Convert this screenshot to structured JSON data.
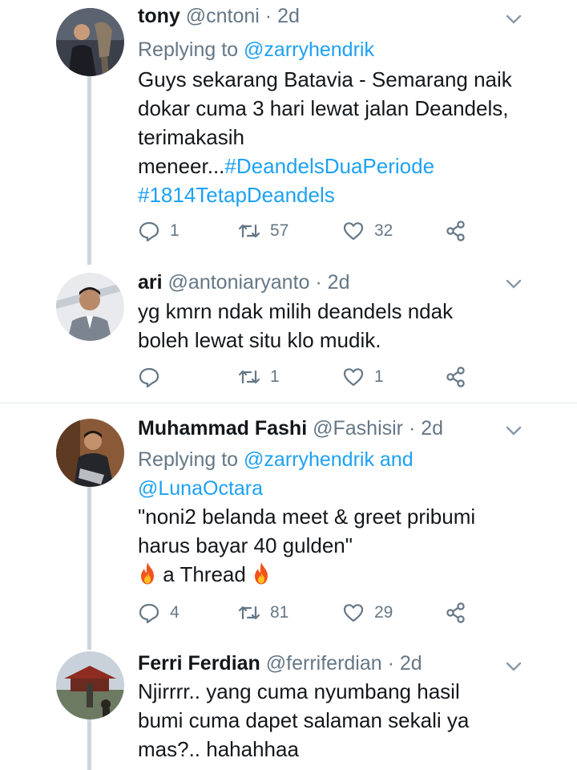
{
  "tweets": [
    {
      "name": "tony",
      "handle": "@cntoni",
      "sep": "·",
      "time": "2d",
      "replying_prefix": "Replying to",
      "replying_to": "@zarryhendrik",
      "body_lines": [
        "Guys sekarang Batavia - Semarang naik",
        "dokar cuma 3 hari lewat jalan Deandels,",
        "terimakasih"
      ],
      "body_tail_text": "meneer...",
      "hashtag_1": "#DeandelsDuaPeriode",
      "hashtag_2": "#1814TetapDeandels",
      "replies": "1",
      "retweets": "57",
      "likes": "32"
    },
    {
      "name": "ari",
      "handle": "@antoniaryanto",
      "sep": "·",
      "time": "2d",
      "body_lines": [
        "yg kmrn ndak milih deandels ndak",
        "boleh lewat situ klo mudik."
      ],
      "replies": "",
      "retweets": "1",
      "likes": "1"
    },
    {
      "name": "Muhammad Fashi",
      "handle": "@Fashisir",
      "sep": "·",
      "time": "2d",
      "replying_prefix": "Replying to",
      "replying_to": "@zarryhendrik",
      "replying_and": "and",
      "replying_to_2": "@LunaOctara",
      "body_lines": [
        "\"noni2 belanda meet & greet pribumi",
        "harus bayar 40 gulden\""
      ],
      "thread_text": "a Thread",
      "replies": "4",
      "retweets": "81",
      "likes": "29"
    },
    {
      "name": "Ferri Ferdian",
      "handle": "@ferriferdian",
      "sep": "·",
      "time": "2d",
      "body_lines": [
        "Njirrrr.. yang cuma nyumbang hasil",
        "bumi cuma dapet salaman sekali ya",
        "mas?.. hahahhaa"
      ]
    }
  ],
  "icons": {
    "reply": "reply-icon",
    "retweet": "retweet-icon",
    "like": "heart-icon",
    "share": "share-icon",
    "caret": "chevron-down-icon",
    "fire": "fire-emoji"
  },
  "colors": {
    "link": "#1da1f2",
    "secondary_text": "#657786",
    "thread_line": "#ccd6dd",
    "divider": "#e1e8ed"
  }
}
